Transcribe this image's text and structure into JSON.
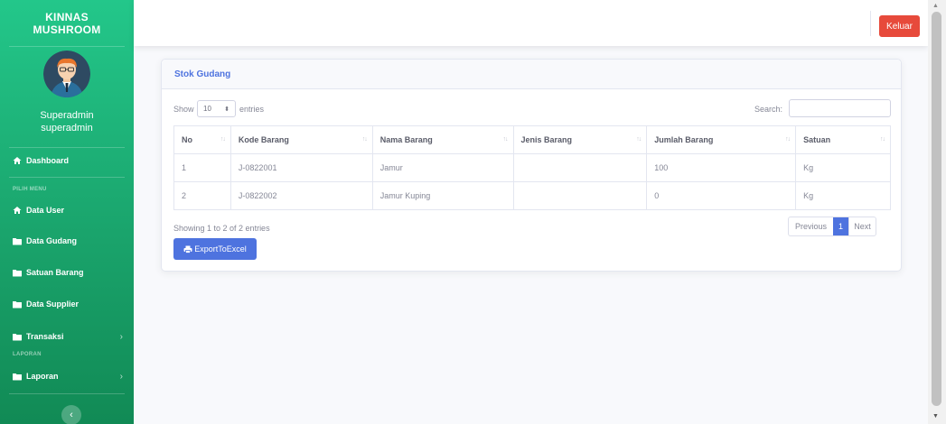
{
  "sidebar": {
    "brand_line1": "KINNAS",
    "brand_line2": "MUSHROOM",
    "user_role": "Superadmin",
    "user_name": "superadmin",
    "dashboard": "Dashboard",
    "heading_pilih_menu": "PILIH MENU",
    "heading_laporan": "LAPORAN",
    "items": [
      {
        "label": "Data User",
        "icon": "home-icon"
      },
      {
        "label": "Data Gudang",
        "icon": "folder-icon"
      },
      {
        "label": "Satuan Barang",
        "icon": "folder-icon"
      },
      {
        "label": "Data Supplier",
        "icon": "folder-icon"
      },
      {
        "label": "Transaksi",
        "icon": "folder-icon",
        "chevron": "›"
      },
      {
        "label": "Laporan",
        "icon": "folder-icon",
        "chevron": "›"
      }
    ],
    "toggle_label": "‹"
  },
  "topbar": {
    "logout_label": "Keluar"
  },
  "card": {
    "title": "Stok Gudang",
    "show_label": "Show",
    "entries_label": "entries",
    "page_length": "10",
    "search_label": "Search:",
    "search_value": "",
    "columns": [
      "No",
      "Kode Barang",
      "Nama Barang",
      "Jenis Barang",
      "Jumlah Barang",
      "Satuan"
    ],
    "rows": [
      [
        "1",
        "J-0822001",
        "Jamur",
        "",
        "100",
        "Kg"
      ],
      [
        "2",
        "J-0822002",
        "Jamur Kuping",
        "",
        "0",
        "Kg"
      ]
    ],
    "info": "Showing 1 to 2 of 2 entries",
    "pagination": {
      "previous": "Previous",
      "current": "1",
      "next": "Next"
    },
    "export_label": "ExportToExcel"
  },
  "colors": {
    "sidebar_top": "#23c78a",
    "sidebar_bottom": "#118a55",
    "primary": "#4e73df",
    "danger": "#e74a3b"
  }
}
